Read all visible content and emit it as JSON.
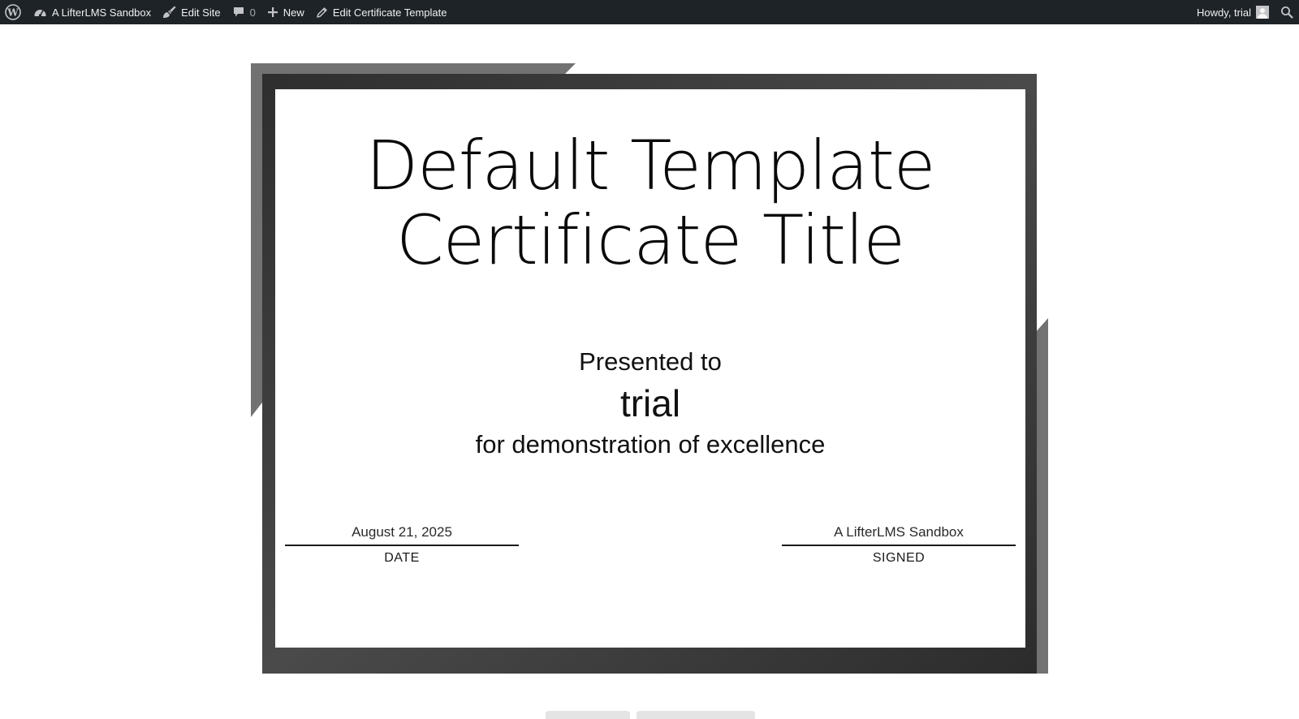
{
  "adminbar": {
    "site_name": "A LifterLMS Sandbox",
    "edit_site": "Edit Site",
    "comments_count": "0",
    "new_label": "New",
    "edit_template": "Edit Certificate Template",
    "howdy": "Howdy, trial",
    "icons": [
      "wordpress-logo-icon",
      "dashboard-icon",
      "brush-icon",
      "comment-icon",
      "plus-icon",
      "pencil-icon",
      "avatar",
      "search-icon"
    ]
  },
  "certificate": {
    "title_line1": "Default Template",
    "title_line2": "Certificate Title",
    "presented_to": "Presented to",
    "recipient": "trial",
    "reason": "for demonstration of excellence",
    "date_value": "August 21, 2025",
    "date_label": "DATE",
    "signed_value": "A LifterLMS Sandbox",
    "signed_label": "SIGNED"
  },
  "colors": {
    "adminbar_bg": "#1d2327",
    "frame_dark": "#2f2f2f",
    "frame_mid": "#555555",
    "frame_light": "#727272"
  }
}
